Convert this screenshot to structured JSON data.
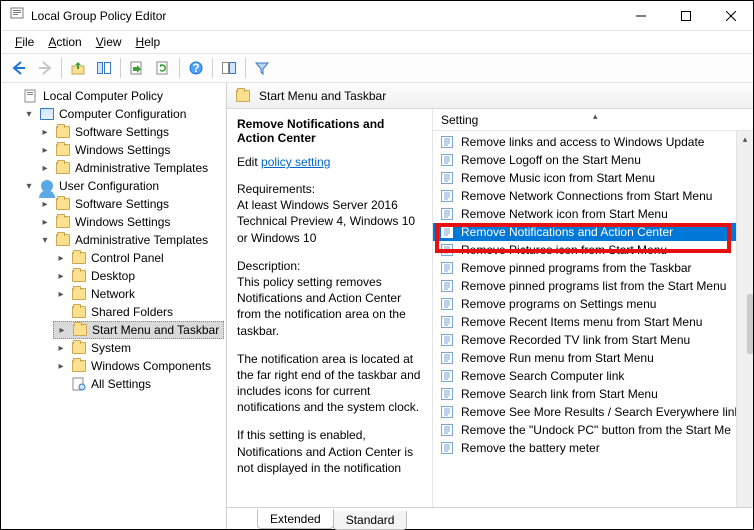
{
  "window": {
    "title": "Local Group Policy Editor"
  },
  "menubar": {
    "file": "File",
    "action": "Action",
    "view": "View",
    "help": "Help"
  },
  "tree": {
    "root": "Local Computer Policy",
    "computer": {
      "label": "Computer Configuration",
      "children": {
        "software": "Software Settings",
        "windows": "Windows Settings",
        "admin": "Administrative Templates"
      }
    },
    "user": {
      "label": "User Configuration",
      "children": {
        "software": "Software Settings",
        "windows": "Windows Settings",
        "admin": {
          "label": "Administrative Templates",
          "children": {
            "control_panel": "Control Panel",
            "desktop": "Desktop",
            "network": "Network",
            "shared_folders": "Shared Folders",
            "start_menu": "Start Menu and Taskbar",
            "system": "System",
            "windows_components": "Windows Components",
            "all_settings": "All Settings"
          }
        }
      }
    }
  },
  "path_header": "Start Menu and Taskbar",
  "detail": {
    "title": "Remove Notifications and Action Center",
    "edit_prefix": "Edit ",
    "edit_link": "policy setting",
    "requirements_label": "Requirements:",
    "requirements_text": "At least Windows Server 2016 Technical Preview 4, Windows 10 or Windows 10",
    "description_label": "Description:",
    "description_text1": "This policy setting removes Notifications and Action Center from the notification area on the taskbar.",
    "description_text2": "The notification area is located at the far right end of the taskbar and includes icons for current notifications and the system clock.",
    "description_text3": "If this setting is enabled, Notifications and Action Center is not displayed in the notification"
  },
  "list": {
    "header": "Setting",
    "items": [
      "Remove links and access to Windows Update",
      "Remove Logoff on the Start Menu",
      "Remove Music icon from Start Menu",
      "Remove Network Connections from Start Menu",
      "Remove Network icon from Start Menu",
      "Remove Notifications and Action Center",
      "Remove Pictures icon from Start Menu",
      "Remove pinned programs from the Taskbar",
      "Remove pinned programs list from the Start Menu",
      "Remove programs on Settings menu",
      "Remove Recent Items menu from Start Menu",
      "Remove Recorded TV link from Start Menu",
      "Remove Run menu from Start Menu",
      "Remove Search Computer link",
      "Remove Search link from Start Menu",
      "Remove See More Results / Search Everywhere link",
      "Remove the \"Undock PC\" button from the Start Me",
      "Remove the battery meter"
    ],
    "selected_index": 5
  },
  "tabs": {
    "extended": "Extended",
    "standard": "Standard"
  }
}
